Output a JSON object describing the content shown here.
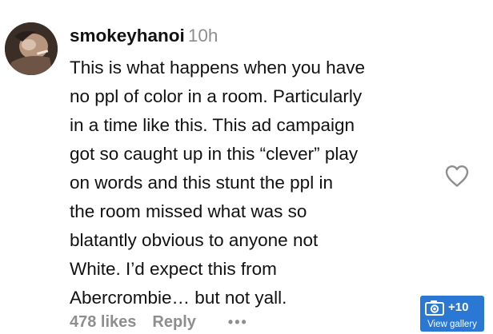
{
  "comment": {
    "username": "smokeyhanoi",
    "time": "10h",
    "lines": [
      "This is what happens when you have",
      "no ppl of color in a room. Particularly",
      "in a time like this. This ad campaign",
      "got so caught up in this “clever” play",
      "on words and this stunt the ppl in",
      "the room missed what was so",
      "blatantly obvious to anyone not",
      "White. I’d expect this from",
      "Abercrombie… but not yall."
    ],
    "likes": "478 likes",
    "reply_label": "Reply",
    "more_label": "•••",
    "like_icon": "heart-outline-icon"
  },
  "gallery": {
    "count": "+10",
    "label": "View gallery",
    "icon": "camera-icon",
    "color": "#2b78d4"
  },
  "colors": {
    "text": "#111111",
    "muted": "#8e8e8e",
    "background": "#ffffff"
  }
}
